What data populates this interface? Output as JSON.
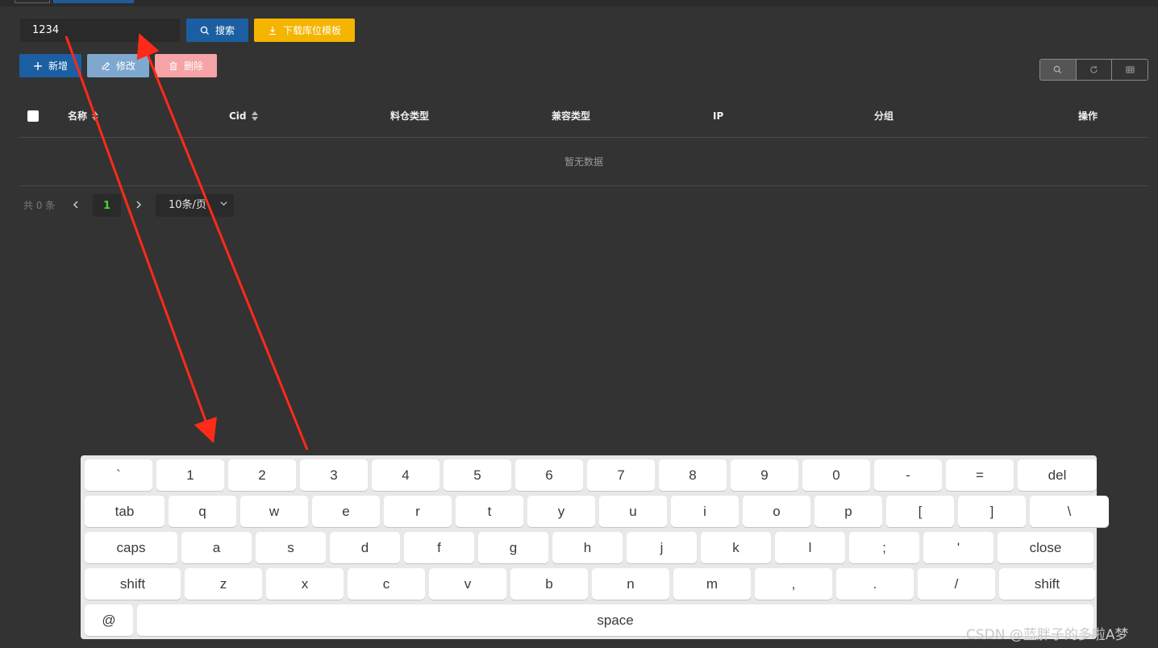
{
  "search": {
    "value": "1234",
    "search_label": "搜索",
    "download_label": "下载库位模板"
  },
  "actions": {
    "add_label": "新增",
    "edit_label": "修改",
    "delete_label": "删除"
  },
  "table": {
    "headers": [
      "名称",
      "Cid",
      "料仓类型",
      "兼容类型",
      "IP",
      "分组",
      "操作"
    ],
    "empty_text": "暂无数据"
  },
  "pagination": {
    "total_text": "共 0 条",
    "current_page": "1",
    "page_size": "10条/页"
  },
  "keyboard": {
    "rows": [
      [
        "`",
        "1",
        "2",
        "3",
        "4",
        "5",
        "6",
        "7",
        "8",
        "9",
        "0",
        "-",
        "=",
        "del"
      ],
      [
        "tab",
        "q",
        "w",
        "e",
        "r",
        "t",
        "y",
        "u",
        "i",
        "o",
        "p",
        "[",
        "]",
        "\\"
      ],
      [
        "caps",
        "a",
        "s",
        "d",
        "f",
        "g",
        "h",
        "j",
        "k",
        "l",
        ";",
        "'",
        "close"
      ],
      [
        "shift",
        "z",
        "x",
        "c",
        "v",
        "b",
        "n",
        "m",
        ",",
        ".",
        "/",
        "shift"
      ],
      [
        "@",
        "space"
      ]
    ]
  },
  "watermark": "CSDN @蓝胖子的多啦A梦",
  "colors": {
    "background": "#333333",
    "primary": "#1b5fa2",
    "warning": "#f5b400",
    "danger": "#f5a3a6",
    "annotation": "#ff2a1a",
    "current_page": "#3fdc2f"
  }
}
